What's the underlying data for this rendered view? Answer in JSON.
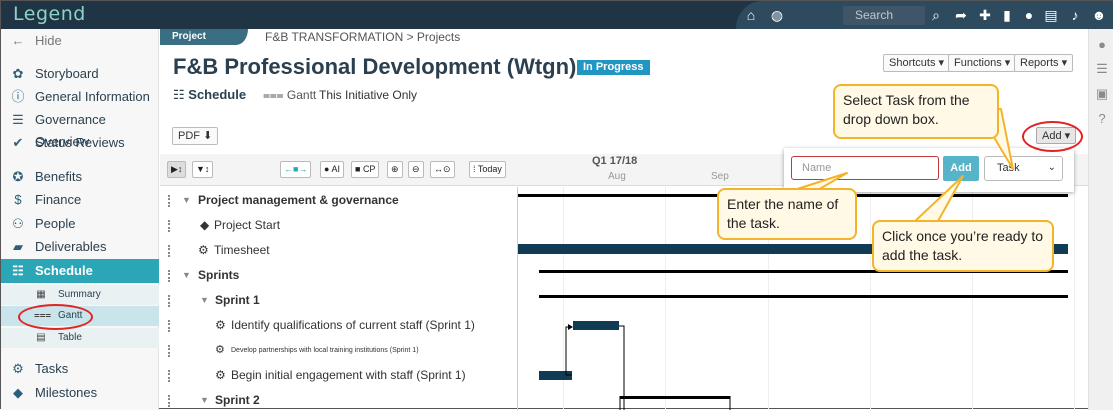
{
  "app": {
    "logo": "Legend"
  },
  "topbar": {
    "search_placeholder": "Search",
    "icons": [
      "home-icon",
      "globe-icon",
      "search-icon",
      "share-icon",
      "plus-icon",
      "bookmark-icon",
      "comment-icon",
      "document-icon",
      "bell-icon",
      "user-icon"
    ]
  },
  "sidebar": {
    "hide": "Hide",
    "items": [
      {
        "label": "Storyboard",
        "icon": "palette-icon"
      },
      {
        "label": "General Information",
        "icon": "info-icon"
      },
      {
        "label": "Governance Overview",
        "icon": "governance-icon"
      },
      {
        "label": "Status Reviews",
        "icon": "check-icon"
      },
      {
        "label": "Benefits",
        "icon": "medal-icon"
      },
      {
        "label": "Finance",
        "icon": "dollar-icon"
      },
      {
        "label": "People",
        "icon": "people-icon"
      },
      {
        "label": "Deliverables",
        "icon": "truck-icon"
      },
      {
        "label": "Schedule",
        "icon": "schedule-icon"
      },
      {
        "label": "Tasks",
        "icon": "tasks-icon"
      },
      {
        "label": "Milestones",
        "icon": "diamond-icon"
      }
    ],
    "schedule_sub": [
      {
        "label": "Summary"
      },
      {
        "label": "Gantt"
      },
      {
        "label": "Table"
      }
    ]
  },
  "header": {
    "project_tag": "Project",
    "breadcrumb": "F&B TRANSFORMATION > Projects",
    "title": "F&B Professional Development (Wtgn)",
    "status": "In Progress",
    "shortcuts": "Shortcuts",
    "functions": "Functions",
    "reports": "Reports",
    "schedule_label": "Schedule",
    "view": "Gantt",
    "initiative_filter": "This Initiative Only",
    "pdf": "PDF",
    "add": "Add"
  },
  "gantt": {
    "toolbar": {
      "ai": "AI",
      "cp": "CP",
      "today": "Today"
    },
    "quarter": "Q1 17/18",
    "months": [
      "Aug",
      "Sep"
    ],
    "tasks": [
      {
        "name": "Project management & governance",
        "bold": true
      },
      {
        "name": "Project Start",
        "bold": false
      },
      {
        "name": "Timesheet",
        "bold": false
      },
      {
        "name": "Sprints",
        "bold": true
      },
      {
        "name": "Sprint 1",
        "bold": true
      },
      {
        "name": "Identify qualifications of current staff (Sprint 1)",
        "bold": false
      },
      {
        "name": "Develop partnerships with local training institutions (Sprint 1)",
        "bold": false
      },
      {
        "name": "Begin initial engagement with staff (Sprint 1)",
        "bold": false
      },
      {
        "name": "Sprint 2",
        "bold": true
      }
    ]
  },
  "add_panel": {
    "name_placeholder": "Name",
    "add_button": "Add",
    "type_value": "Task"
  },
  "callouts": {
    "select_task": "Select Task from the drop down box.",
    "enter_name": "Enter the name of the task.",
    "click_add": "Click once you’re ready to add the task."
  },
  "colors": {
    "accent": "#2aa6b6",
    "topbar": "#1f3545",
    "bar": "#0f3b54",
    "callout_border": "#f4b42a",
    "highlight_circle": "#e02424"
  }
}
